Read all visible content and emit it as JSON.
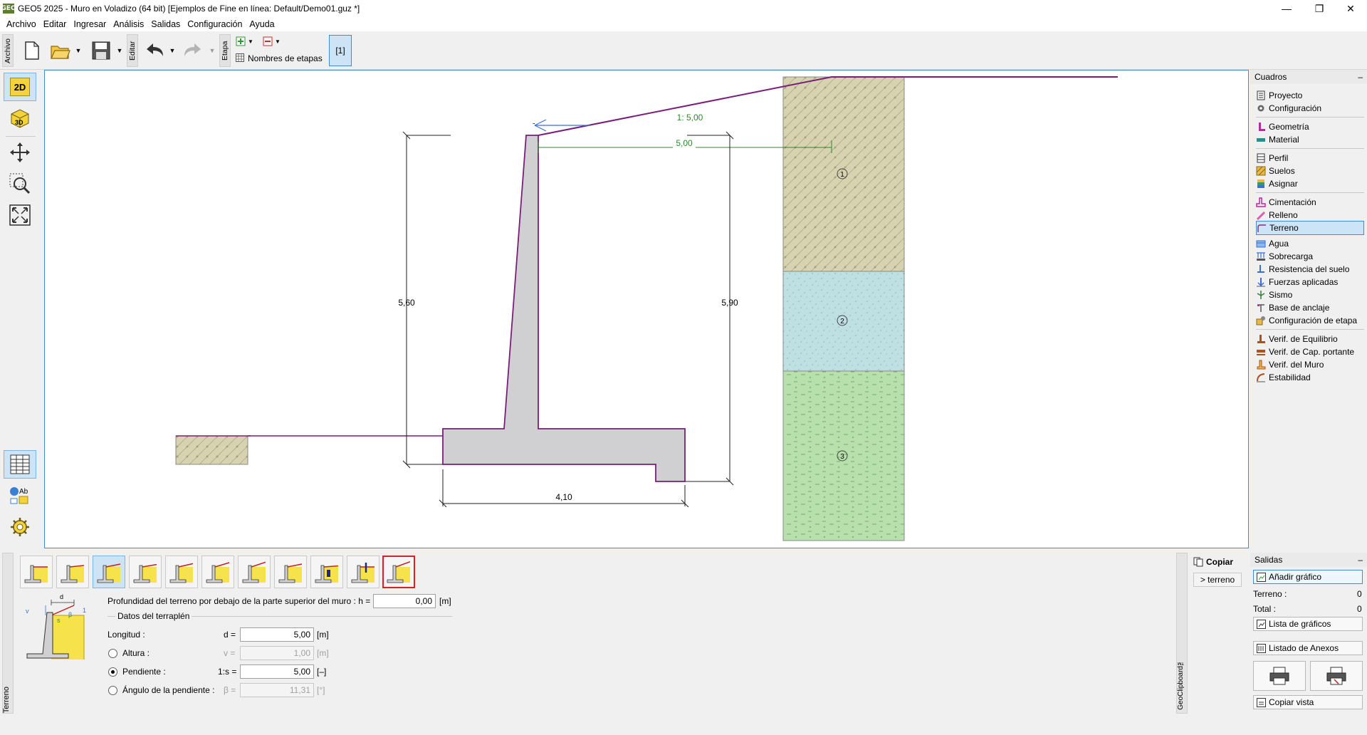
{
  "window": {
    "title": "GEO5 2025 - Muro en Voladizo (64 bit) [Ejemplos de Fine en línea: Default/Demo01.guz *]",
    "logo_text": "GEO",
    "minimize": "—",
    "restore": "❐",
    "close": "✕"
  },
  "menu": [
    "Archivo",
    "Editar",
    "Ingresar",
    "Análisis",
    "Salidas",
    "Configuración",
    "Ayuda"
  ],
  "toolbar": {
    "group_archivo": "Archivo",
    "group_editar": "Editar",
    "group_etapa": "Etapa",
    "stage_names_label": "Nombres de etapas",
    "stage_button": "[1]"
  },
  "left_tools": {
    "view2d": "2D",
    "view3d": "3D",
    "text_tool": "Ab"
  },
  "drawing": {
    "slope_label": "1: 5,00",
    "length_label": "5,00",
    "wall_height": "5,60",
    "total_height": "5,90",
    "base_width": "4,10",
    "layers": [
      "1",
      "2",
      "3"
    ]
  },
  "right_panel": {
    "header": "Cuadros",
    "collapse": "–",
    "items": [
      {
        "label": "Proyecto",
        "icon": "document-icon"
      },
      {
        "label": "Configuración",
        "icon": "gear-icon"
      },
      {
        "label": "Geometría",
        "icon": "geometry-icon"
      },
      {
        "label": "Material",
        "icon": "material-icon"
      },
      {
        "label": "Perfil",
        "icon": "profile-icon"
      },
      {
        "label": "Suelos",
        "icon": "soils-icon"
      },
      {
        "label": "Asignar",
        "icon": "assign-icon"
      },
      {
        "label": "Cimentación",
        "icon": "foundation-icon"
      },
      {
        "label": "Relleno",
        "icon": "backfill-icon"
      },
      {
        "label": "Terreno",
        "icon": "terrain-icon"
      },
      {
        "label": "Agua",
        "icon": "water-icon"
      },
      {
        "label": "Sobrecarga",
        "icon": "surcharge-icon"
      },
      {
        "label": "Resistencia del suelo",
        "icon": "resistance-icon"
      },
      {
        "label": "Fuerzas aplicadas",
        "icon": "forces-icon"
      },
      {
        "label": "Sismo",
        "icon": "earthquake-icon"
      },
      {
        "label": "Base de anclaje",
        "icon": "anchor-icon"
      },
      {
        "label": "Configuración de etapa",
        "icon": "stage-settings-icon"
      },
      {
        "label": "Verif. de Equilibrio",
        "icon": "equilibrium-icon"
      },
      {
        "label": "Verif. de Cap. portante",
        "icon": "bearing-icon"
      },
      {
        "label": "Verif. del Muro",
        "icon": "wall-check-icon"
      },
      {
        "label": "Estabilidad",
        "icon": "stability-icon"
      }
    ]
  },
  "bottom": {
    "sidebar_label": "Terreno",
    "depth_label": "Profundidad del terreno por debajo de la parte superior del muro : h =",
    "depth_value": "0,00",
    "unit_m": "[m]",
    "unit_dash": "[–]",
    "unit_deg": "[°]",
    "group_title": "Datos del terraplén",
    "length_label": "Longitud :",
    "length_sym": "d =",
    "length_value": "5,00",
    "height_label": "Altura :",
    "height_sym": "v =",
    "height_value": "1,00",
    "slope_label": "Pendiente :",
    "slope_sym": "1:s =",
    "slope_value": "5,00",
    "angle_label": "Ángulo de la pendiente :",
    "angle_sym": "β =",
    "angle_value": "11,31",
    "sketch_d": "d",
    "sketch_v": "v",
    "sketch_beta": "β",
    "sketch_s": "s",
    "sketch_1": "1"
  },
  "clipboard": {
    "label": "GeoClipboard™",
    "copy": "Copiar",
    "terreno": "> terreno"
  },
  "outputs": {
    "header": "Salidas",
    "collapse": "–",
    "add_graphic": "Añadir gráfico",
    "terreno_label": "Terreno :",
    "terreno_count": "0",
    "total_label": "Total :",
    "total_count": "0",
    "graphics_list": "Lista de gráficos",
    "annex_list": "Listado de Anexos",
    "copy_view": "Copiar vista"
  }
}
